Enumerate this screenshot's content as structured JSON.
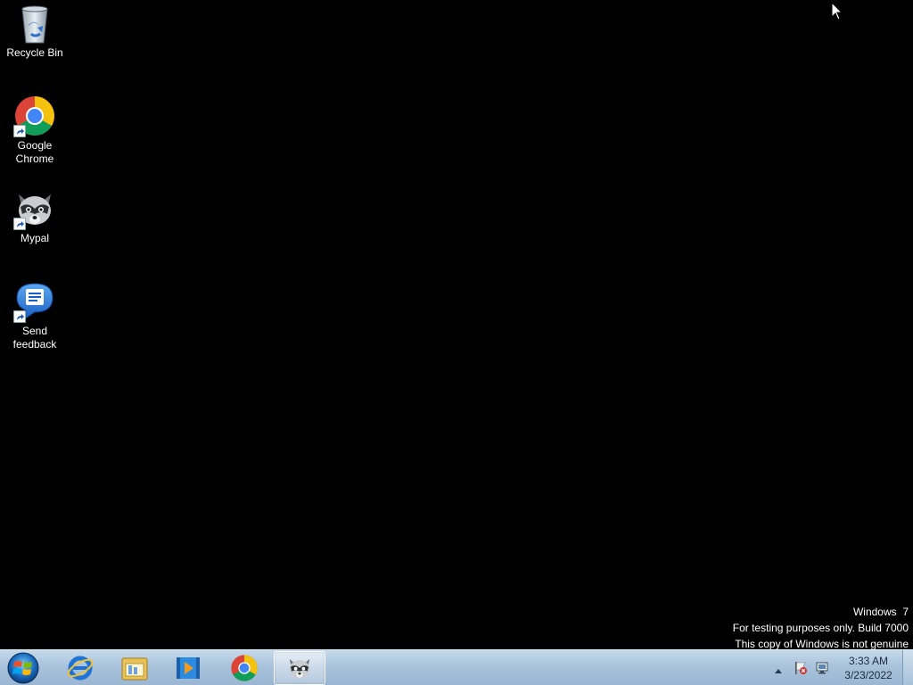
{
  "desktop": {
    "icons": [
      {
        "name": "recycle-bin",
        "label": "Recycle Bin"
      },
      {
        "name": "google-chrome",
        "label": "Google Chrome"
      },
      {
        "name": "mypal",
        "label": "Mypal"
      },
      {
        "name": "send-feedback",
        "label": "Send feedback"
      }
    ]
  },
  "watermark": {
    "line1": "Windows  7",
    "line2": "For testing purposes only. Build 7000",
    "line3": "This copy of Windows is not genuine"
  },
  "taskbar": {
    "pinned": [
      {
        "icon": "internet-explorer-icon"
      },
      {
        "icon": "file-explorer-icon"
      },
      {
        "icon": "media-player-icon"
      },
      {
        "icon": "chrome-icon"
      },
      {
        "icon": "mypal-icon",
        "active": true
      }
    ],
    "clock": {
      "time": "3:33 AM",
      "date": "3/23/2022"
    }
  },
  "colors": {
    "desktop_bg": "#000000",
    "taskbar_top": "#c6d9ea",
    "taskbar_bottom": "#9ab6d2"
  }
}
